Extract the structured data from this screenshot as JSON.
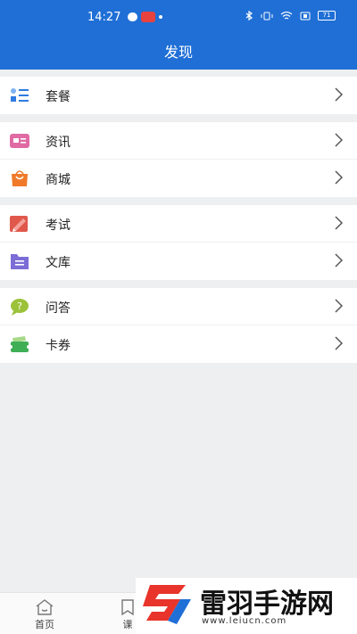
{
  "status_bar": {
    "time": "14:27",
    "battery": "71"
  },
  "header": {
    "title": "发现"
  },
  "groups": [
    {
      "items": [
        {
          "label": "套餐",
          "icon": "plan-list-icon",
          "color": "#2f7be0"
        }
      ]
    },
    {
      "items": [
        {
          "label": "资讯",
          "icon": "news-icon",
          "color": "#e06aa4"
        },
        {
          "label": "商城",
          "icon": "shopping-bag-icon",
          "color": "#f07a2a"
        }
      ]
    },
    {
      "items": [
        {
          "label": "考试",
          "icon": "exam-pencil-icon",
          "color": "#e0584b"
        },
        {
          "label": "文库",
          "icon": "library-folder-icon",
          "color": "#7c6cd6"
        }
      ]
    },
    {
      "items": [
        {
          "label": "问答",
          "icon": "question-bubble-icon",
          "color": "#9cc23a"
        },
        {
          "label": "卡券",
          "icon": "coupon-ticket-icon",
          "color": "#3fae55"
        }
      ]
    }
  ],
  "tabbar": {
    "tabs": [
      {
        "label": "首页",
        "icon": "home-icon"
      },
      {
        "label": "课",
        "icon": "book-icon"
      }
    ]
  },
  "watermark": {
    "title": "雷羽手游网",
    "url": "www.leiucn.com"
  },
  "colors": {
    "header_blue": "#1f6fd6",
    "background": "#eeeff1"
  }
}
